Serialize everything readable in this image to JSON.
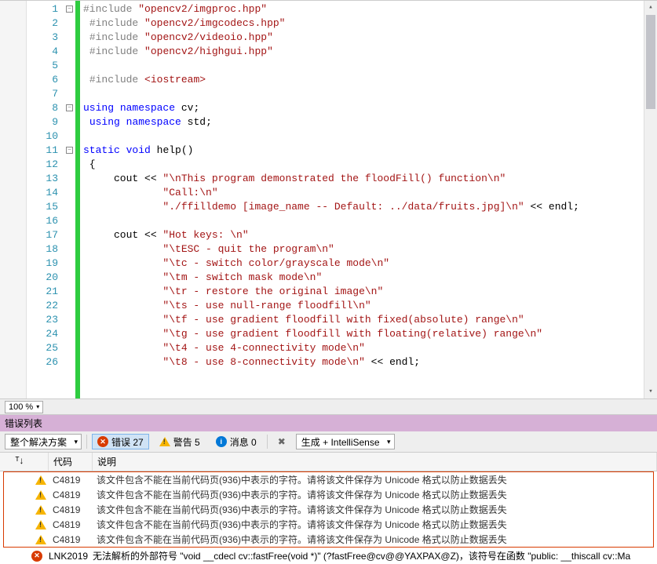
{
  "zoom": "100 %",
  "code": {
    "lines": [
      {
        "n": 1,
        "fold": true,
        "html": "<span class='pp'>#include</span> <span class='inc'>\"opencv2/imgproc.hpp\"</span>"
      },
      {
        "n": 2,
        "html": " <span class='pp'>#include</span> <span class='inc'>\"opencv2/imgcodecs.hpp\"</span>"
      },
      {
        "n": 3,
        "html": " <span class='pp'>#include</span> <span class='inc'>\"opencv2/videoio.hpp\"</span>"
      },
      {
        "n": 4,
        "html": " <span class='pp'>#include</span> <span class='inc'>\"opencv2/highgui.hpp\"</span>"
      },
      {
        "n": 5,
        "html": ""
      },
      {
        "n": 6,
        "html": " <span class='pp'>#include</span> <span class='inc'>&lt;iostream&gt;</span>"
      },
      {
        "n": 7,
        "html": ""
      },
      {
        "n": 8,
        "fold": true,
        "html": "<span class='kw'>using</span> <span class='kw'>namespace</span> cv;"
      },
      {
        "n": 9,
        "html": " <span class='kw'>using</span> <span class='kw'>namespace</span> std;"
      },
      {
        "n": 10,
        "html": ""
      },
      {
        "n": 11,
        "fold": true,
        "html": "<span class='kw'>static</span> <span class='kw'>void</span> help()"
      },
      {
        "n": 12,
        "html": " {"
      },
      {
        "n": 13,
        "html": "     cout &lt;&lt; <span class='str'>\"\\nThis program demonstrated the floodFill() function\\n\"</span>"
      },
      {
        "n": 14,
        "html": "             <span class='str'>\"Call:\\n\"</span>"
      },
      {
        "n": 15,
        "html": "             <span class='str'>\"./ffilldemo [image_name -- Default: ../data/fruits.jpg]\\n\"</span> &lt;&lt; endl;"
      },
      {
        "n": 16,
        "html": ""
      },
      {
        "n": 17,
        "html": "     cout &lt;&lt; <span class='str'>\"Hot keys: \\n\"</span>"
      },
      {
        "n": 18,
        "html": "             <span class='str'>\"\\tESC - quit the program\\n\"</span>"
      },
      {
        "n": 19,
        "html": "             <span class='str'>\"\\tc - switch color/grayscale mode\\n\"</span>"
      },
      {
        "n": 20,
        "html": "             <span class='str'>\"\\tm - switch mask mode\\n\"</span>"
      },
      {
        "n": 21,
        "html": "             <span class='str'>\"\\tr - restore the original image\\n\"</span>"
      },
      {
        "n": 22,
        "html": "             <span class='str'>\"\\ts - use null-range floodfill\\n\"</span>"
      },
      {
        "n": 23,
        "html": "             <span class='str'>\"\\tf - use gradient floodfill with fixed(absolute) range\\n\"</span>"
      },
      {
        "n": 24,
        "html": "             <span class='str'>\"\\tg - use gradient floodfill with floating(relative) range\\n\"</span>"
      },
      {
        "n": 25,
        "html": "             <span class='str'>\"\\t4 - use 4-connectivity mode\\n\"</span>"
      },
      {
        "n": 26,
        "html": "             <span class='str'>\"\\t8 - use 8-connectivity mode\\n\"</span> &lt;&lt; endl;"
      }
    ]
  },
  "errorPanel": {
    "title": "错误列表",
    "scopeDropdown": "整个解决方案",
    "errorsLabel": "错误 27",
    "warningsLabel": "警告 5",
    "messagesLabel": "消息 0",
    "buildDropdown": "生成 + IntelliSense",
    "headers": {
      "code": "代码",
      "desc": "说明"
    },
    "rows": [
      {
        "type": "warn",
        "code": "C4819",
        "desc": "该文件包含不能在当前代码页(936)中表示的字符。请将该文件保存为 Unicode 格式以防止数据丢失"
      },
      {
        "type": "warn",
        "code": "C4819",
        "desc": "该文件包含不能在当前代码页(936)中表示的字符。请将该文件保存为 Unicode 格式以防止数据丢失"
      },
      {
        "type": "warn",
        "code": "C4819",
        "desc": "该文件包含不能在当前代码页(936)中表示的字符。请将该文件保存为 Unicode 格式以防止数据丢失"
      },
      {
        "type": "warn",
        "code": "C4819",
        "desc": "该文件包含不能在当前代码页(936)中表示的字符。请将该文件保存为 Unicode 格式以防止数据丢失"
      },
      {
        "type": "warn",
        "code": "C4819",
        "desc": "该文件包含不能在当前代码页(936)中表示的字符。请将该文件保存为 Unicode 格式以防止数据丢失"
      }
    ],
    "extraRow": {
      "type": "err",
      "code": "LNK2019",
      "desc": "无法解析的外部符号 \"void __cdecl cv::fastFree(void *)\" (?fastFree@cv@@YAXPAX@Z)，该符号在函数 \"public: __thiscall cv::Ma"
    }
  }
}
